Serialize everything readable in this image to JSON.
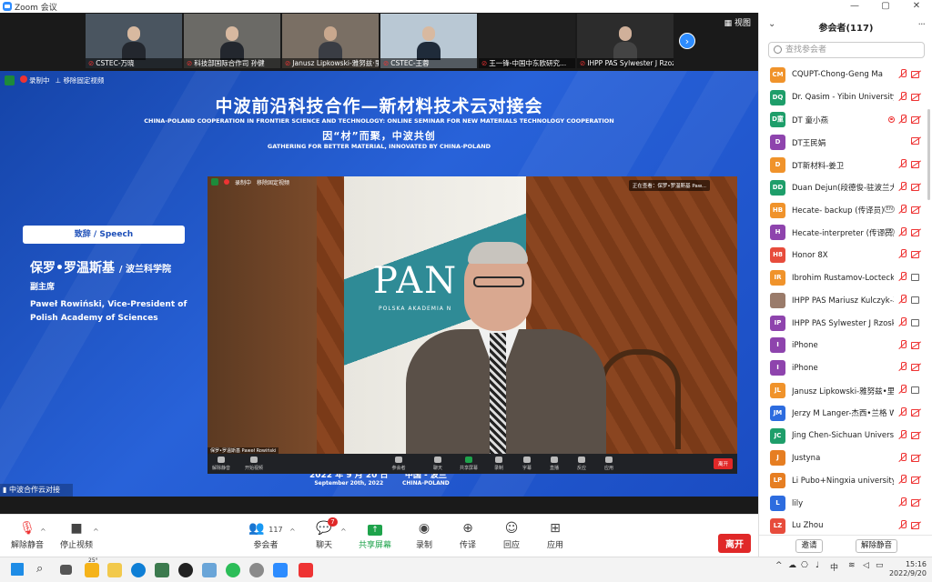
{
  "window": {
    "title": "Zoom 会议",
    "controls": [
      "—",
      "▢",
      "✕"
    ]
  },
  "strip": {
    "view_label": "视图",
    "thumbs": [
      {
        "name": "CSTEC-万晓"
      },
      {
        "name": "科技部国际合作司 孙健"
      },
      {
        "name": "Janusz Lipkowski-雅努兹·里普..."
      },
      {
        "name": "CSTEC-王蓉"
      },
      {
        "name": "王一锋-中国中东欧研究..."
      },
      {
        "name": "IHPP PAS Sylwester J Rzoz..."
      }
    ]
  },
  "share": {
    "recording": "录制中",
    "unpin": "移除固定视频",
    "title_cn": "中波前沿科技合作—新材料技术云对接会",
    "title_en": "CHINA-POLAND COOPERATION IN FRONTIER SCIENCE AND TECHNOLOGY: ONLINE SEMINAR FOR NEW MATERIALS TECHNOLOGY COOPERATION",
    "slogan_cn": "因“材”而聚，中波共创",
    "slogan_en": "GATHERING FOR BETTER MATERIAL, INNOVATED BY CHINA-POLAND",
    "speech": "致辞 / Speech",
    "speaker_cn": "保罗•罗温斯基",
    "speaker_org": "/ 波兰科学院",
    "speaker_role": "副主席",
    "speaker_en": "Paweł Rowiński, Vice-President of Polish Academy of Sciences",
    "date_cn": "2022 年 9 月 20 日",
    "date_en": "September 20th, 2022",
    "place_cn": "中国 - 波兰",
    "place_en": "CHINA-POLAND",
    "ticker": "中波合作云对接",
    "video": {
      "rec": "录制中",
      "unpin": "移除固定视频",
      "sharing": "正在查看：保罗•罗温斯基 Paw...",
      "logo": "PAN",
      "logo_sub": "POLSKA AKADEMIA N",
      "name": "保罗•罗温斯基 Paweł Rowiński",
      "bar": [
        "解除静音",
        "开始视频",
        "参会者",
        "聊天",
        "共享屏幕",
        "录制",
        "字幕",
        "直播",
        "反应",
        "应用"
      ],
      "leave": "离开"
    }
  },
  "toolbar": {
    "unmute": "解除静音",
    "stop_video": "停止视频",
    "participants": "参会者",
    "participants_count": "117",
    "chat": "聊天",
    "chat_badge": "7",
    "share_screen": "共享屏幕",
    "record": "录制",
    "interpret": "传译",
    "reactions": "回应",
    "apps": "应用",
    "leave": "离开"
  },
  "panel": {
    "title": "参会者(117)",
    "search_placeholder": "查找参会者",
    "invite": "邀请",
    "unmute": "解除静音",
    "participants": [
      {
        "initials": "CM",
        "color": "#f0932b",
        "name": "CQUPT-Chong-Geng Ma",
        "icons": [
          "mic",
          "cam"
        ]
      },
      {
        "initials": "DQ",
        "color": "#1e9e6a",
        "name": "Dr. Qasim - Yibin University",
        "icons": [
          "mic",
          "cam"
        ]
      },
      {
        "initials": "D童",
        "color": "#1e9e6a",
        "name": "DT 童小燕",
        "icons": [
          "dot",
          "mic",
          "cam"
        ]
      },
      {
        "initials": "D",
        "color": "#8e44ad",
        "name": "DT王民娟",
        "icons": [
          "cam"
        ]
      },
      {
        "initials": "D",
        "color": "#f0932b",
        "name": "DT新材料-姜卫",
        "icons": [
          "mic",
          "cam"
        ]
      },
      {
        "initials": "DD",
        "color": "#1e9e6a",
        "name": "Duan Dejun(段德俊-驻波兰大...",
        "icons": [
          "mic",
          "cam"
        ]
      },
      {
        "initials": "HB",
        "color": "#f0932b",
        "name": "Hecate- backup (传译员)",
        "icons": [
          "en",
          "mic",
          "cam"
        ]
      },
      {
        "initials": "H",
        "color": "#8e44ad",
        "name": "Hecate-interpreter (传译员)",
        "icons": [
          "en",
          "mic",
          "cam"
        ]
      },
      {
        "initials": "H8",
        "color": "#e74c3c",
        "name": "Honor 8X",
        "icons": [
          "mic",
          "cam"
        ]
      },
      {
        "initials": "IR",
        "color": "#f0932b",
        "name": "Ibrohim Rustamov-Locteck Inc.",
        "icons": [
          "mic",
          "camon"
        ]
      },
      {
        "initials": "",
        "color": "#9a7b6a",
        "name": "IHPP PAS Mariusz Kulczyk-马里...",
        "icons": [
          "mic",
          "camon"
        ]
      },
      {
        "initials": "IP",
        "color": "#8e44ad",
        "name": "IHPP PAS Sylwester J Rzoska赛...",
        "icons": [
          "mic",
          "camon"
        ]
      },
      {
        "initials": "I",
        "color": "#8e44ad",
        "name": "iPhone",
        "icons": [
          "mic",
          "cam"
        ]
      },
      {
        "initials": "I",
        "color": "#8e44ad",
        "name": "iPhone",
        "icons": [
          "mic",
          "cam"
        ]
      },
      {
        "initials": "JL",
        "color": "#f0932b",
        "name": "Janusz Lipkowski-雅努兹•里普...",
        "icons": [
          "mic",
          "camon"
        ]
      },
      {
        "initials": "JM",
        "color": "#2d6cdf",
        "name": "Jerzy M Langer-杰西•兰格 Wars...",
        "icons": [
          "mic",
          "cam"
        ]
      },
      {
        "initials": "JC",
        "color": "#1e9e6a",
        "name": "Jing Chen-Sichuan University",
        "icons": [
          "mic",
          "cam"
        ]
      },
      {
        "initials": "J",
        "color": "#e67e22",
        "name": "Justyna",
        "icons": [
          "mic",
          "cam"
        ]
      },
      {
        "initials": "LP",
        "color": "#e67e22",
        "name": "Li Pubo+Ningxia university",
        "icons": [
          "mic",
          "cam"
        ]
      },
      {
        "initials": "L",
        "color": "#2d6cdf",
        "name": "lily",
        "icons": [
          "mic",
          "cam"
        ]
      },
      {
        "initials": "LZ",
        "color": "#e74c3c",
        "name": "Lu Zhou",
        "icons": [
          "mic",
          "cam"
        ]
      }
    ]
  },
  "taskbar": {
    "weather": "25°",
    "ime": "中",
    "time": "15:16",
    "date": "2022/9/20"
  }
}
